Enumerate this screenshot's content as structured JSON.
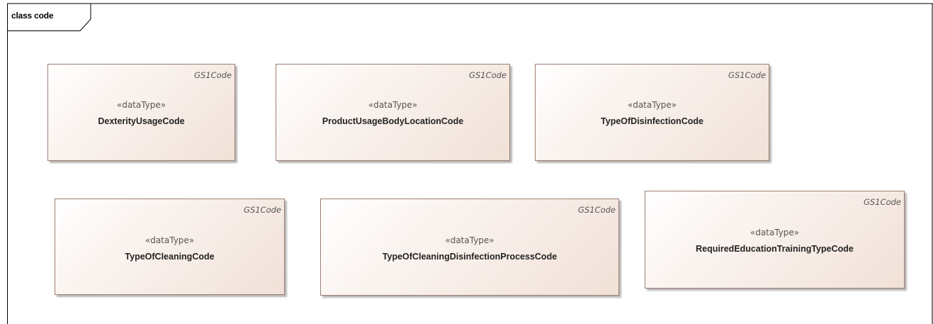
{
  "frame": {
    "label": "class code"
  },
  "classes": [
    {
      "tag": "GS1Code",
      "stereotype": "«dataType»",
      "name": "DexterityUsageCode"
    },
    {
      "tag": "GS1Code",
      "stereotype": "«dataType»",
      "name": "ProductUsageBodyLocationCode"
    },
    {
      "tag": "GS1Code",
      "stereotype": "«dataType»",
      "name": "TypeOfDisinfectionCode"
    },
    {
      "tag": "GS1Code",
      "stereotype": "«dataType»",
      "name": "TypeOfCleaningCode"
    },
    {
      "tag": "GS1Code",
      "stereotype": "«dataType»",
      "name": "TypeOfCleaningDisinfectionProcessCode"
    },
    {
      "tag": "GS1Code",
      "stereotype": "«dataType»",
      "name": "RequiredEducationTrainingTypeCode"
    }
  ],
  "colors": {
    "frame_line": "#000000",
    "box_border": "#9a7f72",
    "box_fill_end": "#f1e1d8"
  }
}
